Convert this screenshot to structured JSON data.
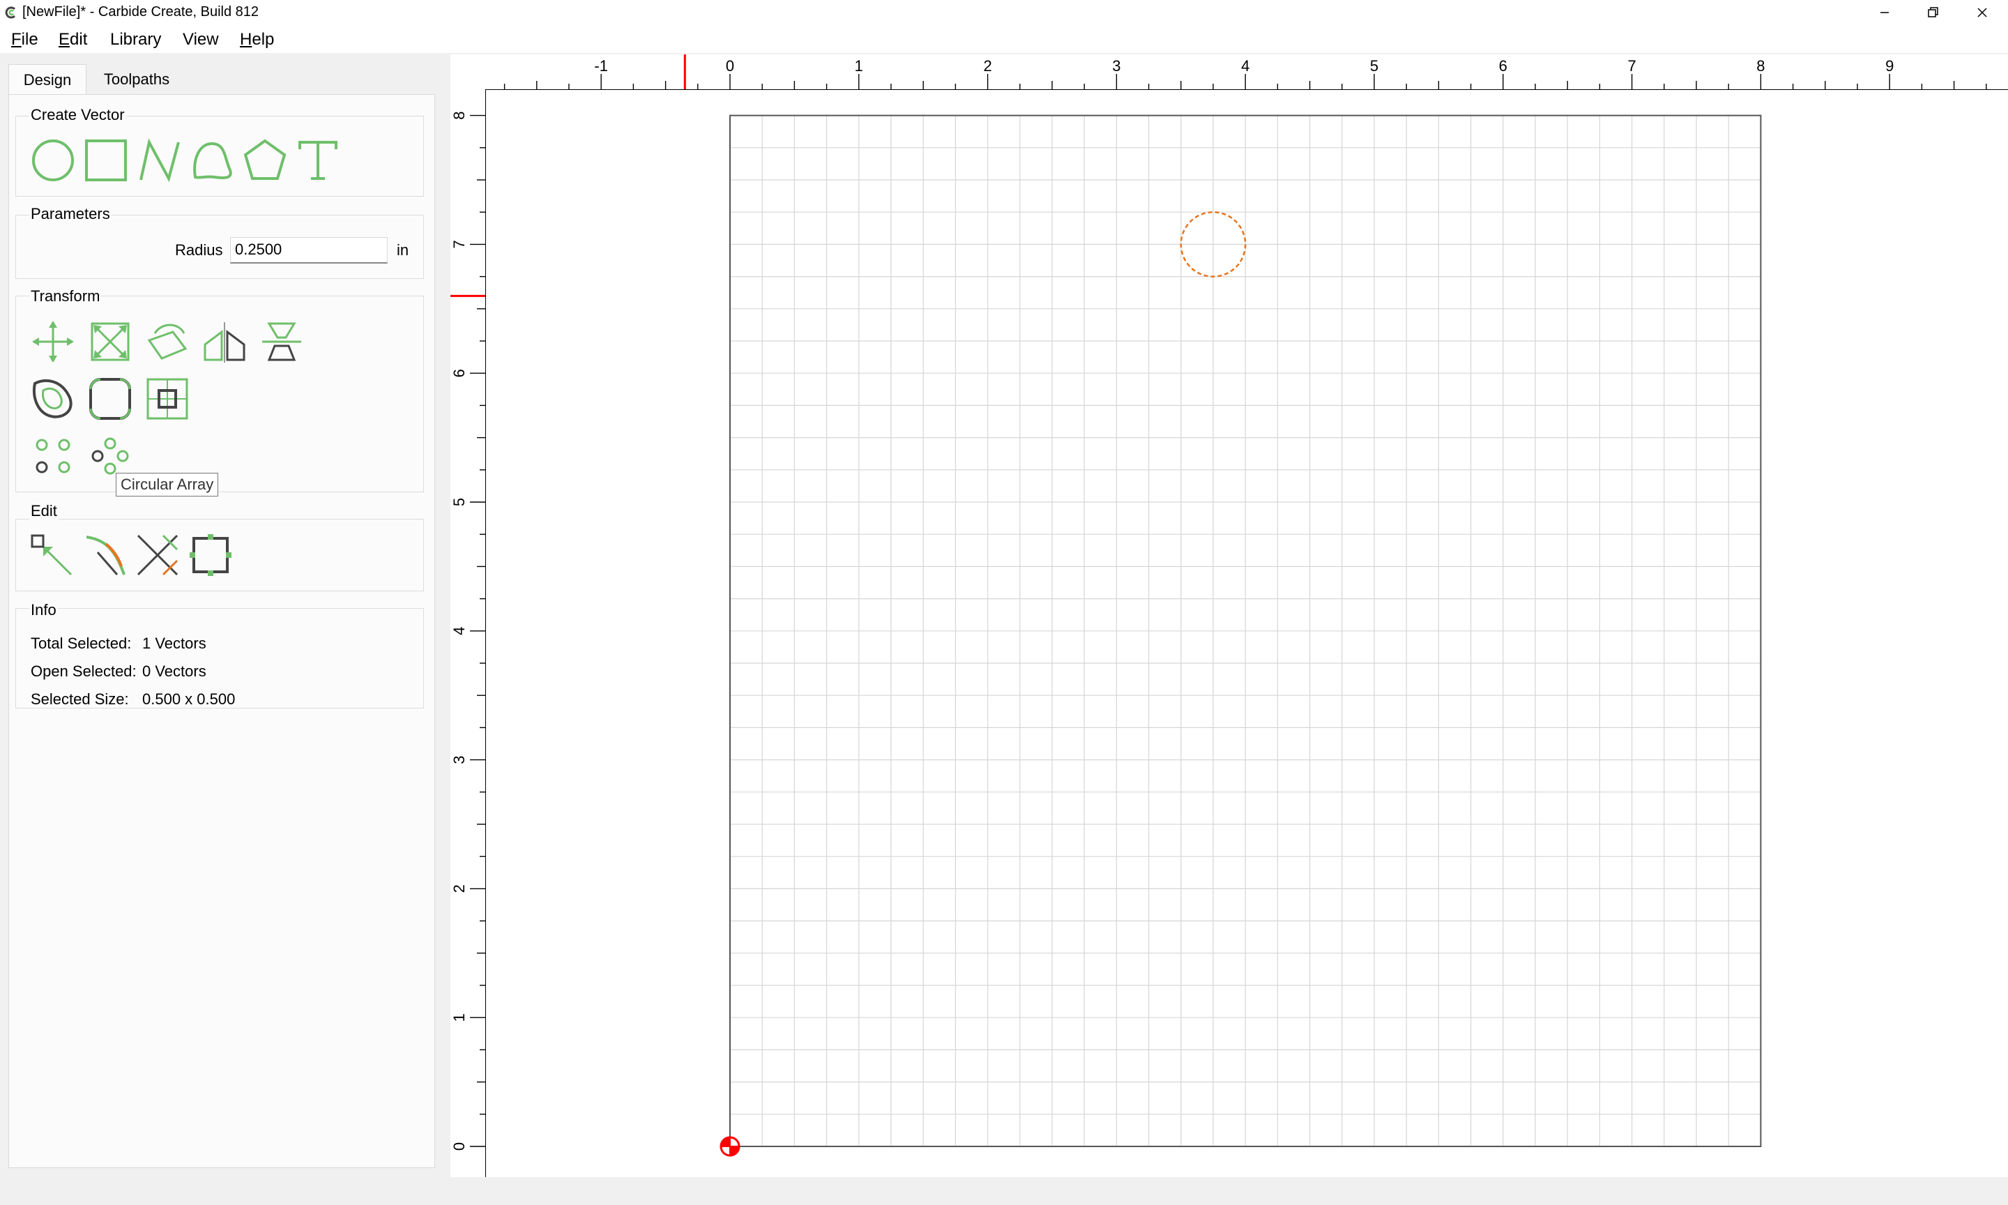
{
  "window": {
    "title": "[NewFile]* - Carbide Create, Build 812"
  },
  "menu": [
    {
      "label": "File",
      "underline": "F",
      "rest": "ile"
    },
    {
      "label": "Edit",
      "underline": "E",
      "rest": "dit"
    },
    {
      "label": "Library",
      "underline": "",
      "rest": "Library"
    },
    {
      "label": "View",
      "underline": "",
      "rest": "View"
    },
    {
      "label": "Help",
      "underline": "H",
      "rest": "elp"
    }
  ],
  "tabs": {
    "design": "Design",
    "toolpaths": "Toolpaths"
  },
  "create_vector": {
    "title": "Create Vector",
    "tools": [
      "circle-icon",
      "rectangle-icon",
      "polyline-icon",
      "curve-icon",
      "polygon-icon",
      "text-icon"
    ]
  },
  "parameters": {
    "title": "Parameters",
    "radius_label": "Radius",
    "radius_value": "0.2500",
    "unit": "in"
  },
  "transform": {
    "title": "Transform",
    "tools": [
      "move-icon",
      "scale-icon",
      "rotate-icon",
      "mirror-icon",
      "align-icon",
      "offset-icon",
      "fillet-icon",
      "center-icon",
      "grid-array-icon",
      "circular-array-icon"
    ],
    "tooltip": "Circular Array"
  },
  "edit": {
    "title": "Edit",
    "tools": [
      "node-edit-icon",
      "trim-icon",
      "boolean-icon",
      "bounding-box-icon"
    ]
  },
  "info": {
    "title": "Info",
    "total_selected_label": "Total Selected:",
    "total_selected_value": "1 Vectors",
    "open_selected_label": "Open Selected:",
    "open_selected_value": "0 Vectors",
    "selected_size_label": "Selected Size:",
    "selected_size_value": "0.500 x 0.500"
  },
  "canvas": {
    "x_ticks": [
      "-1",
      "0",
      "1",
      "2",
      "3",
      "4",
      "5",
      "6",
      "7",
      "8",
      "9"
    ],
    "y_ticks": [
      "8",
      "7",
      "6",
      "5",
      "4",
      "3",
      "2",
      "1",
      "0"
    ],
    "stock_width_in": 8,
    "stock_height_in": 8,
    "circle_center_in": [
      3.75,
      7.0
    ],
    "circle_radius_in": 0.25,
    "cursor_x_in": -0.35,
    "cursor_y_in": 6.6,
    "colors": {
      "grid": "#d6d6d6",
      "circle": "#e8741e",
      "cursor": "#ff0000",
      "accent": "#6fbf6a"
    }
  }
}
